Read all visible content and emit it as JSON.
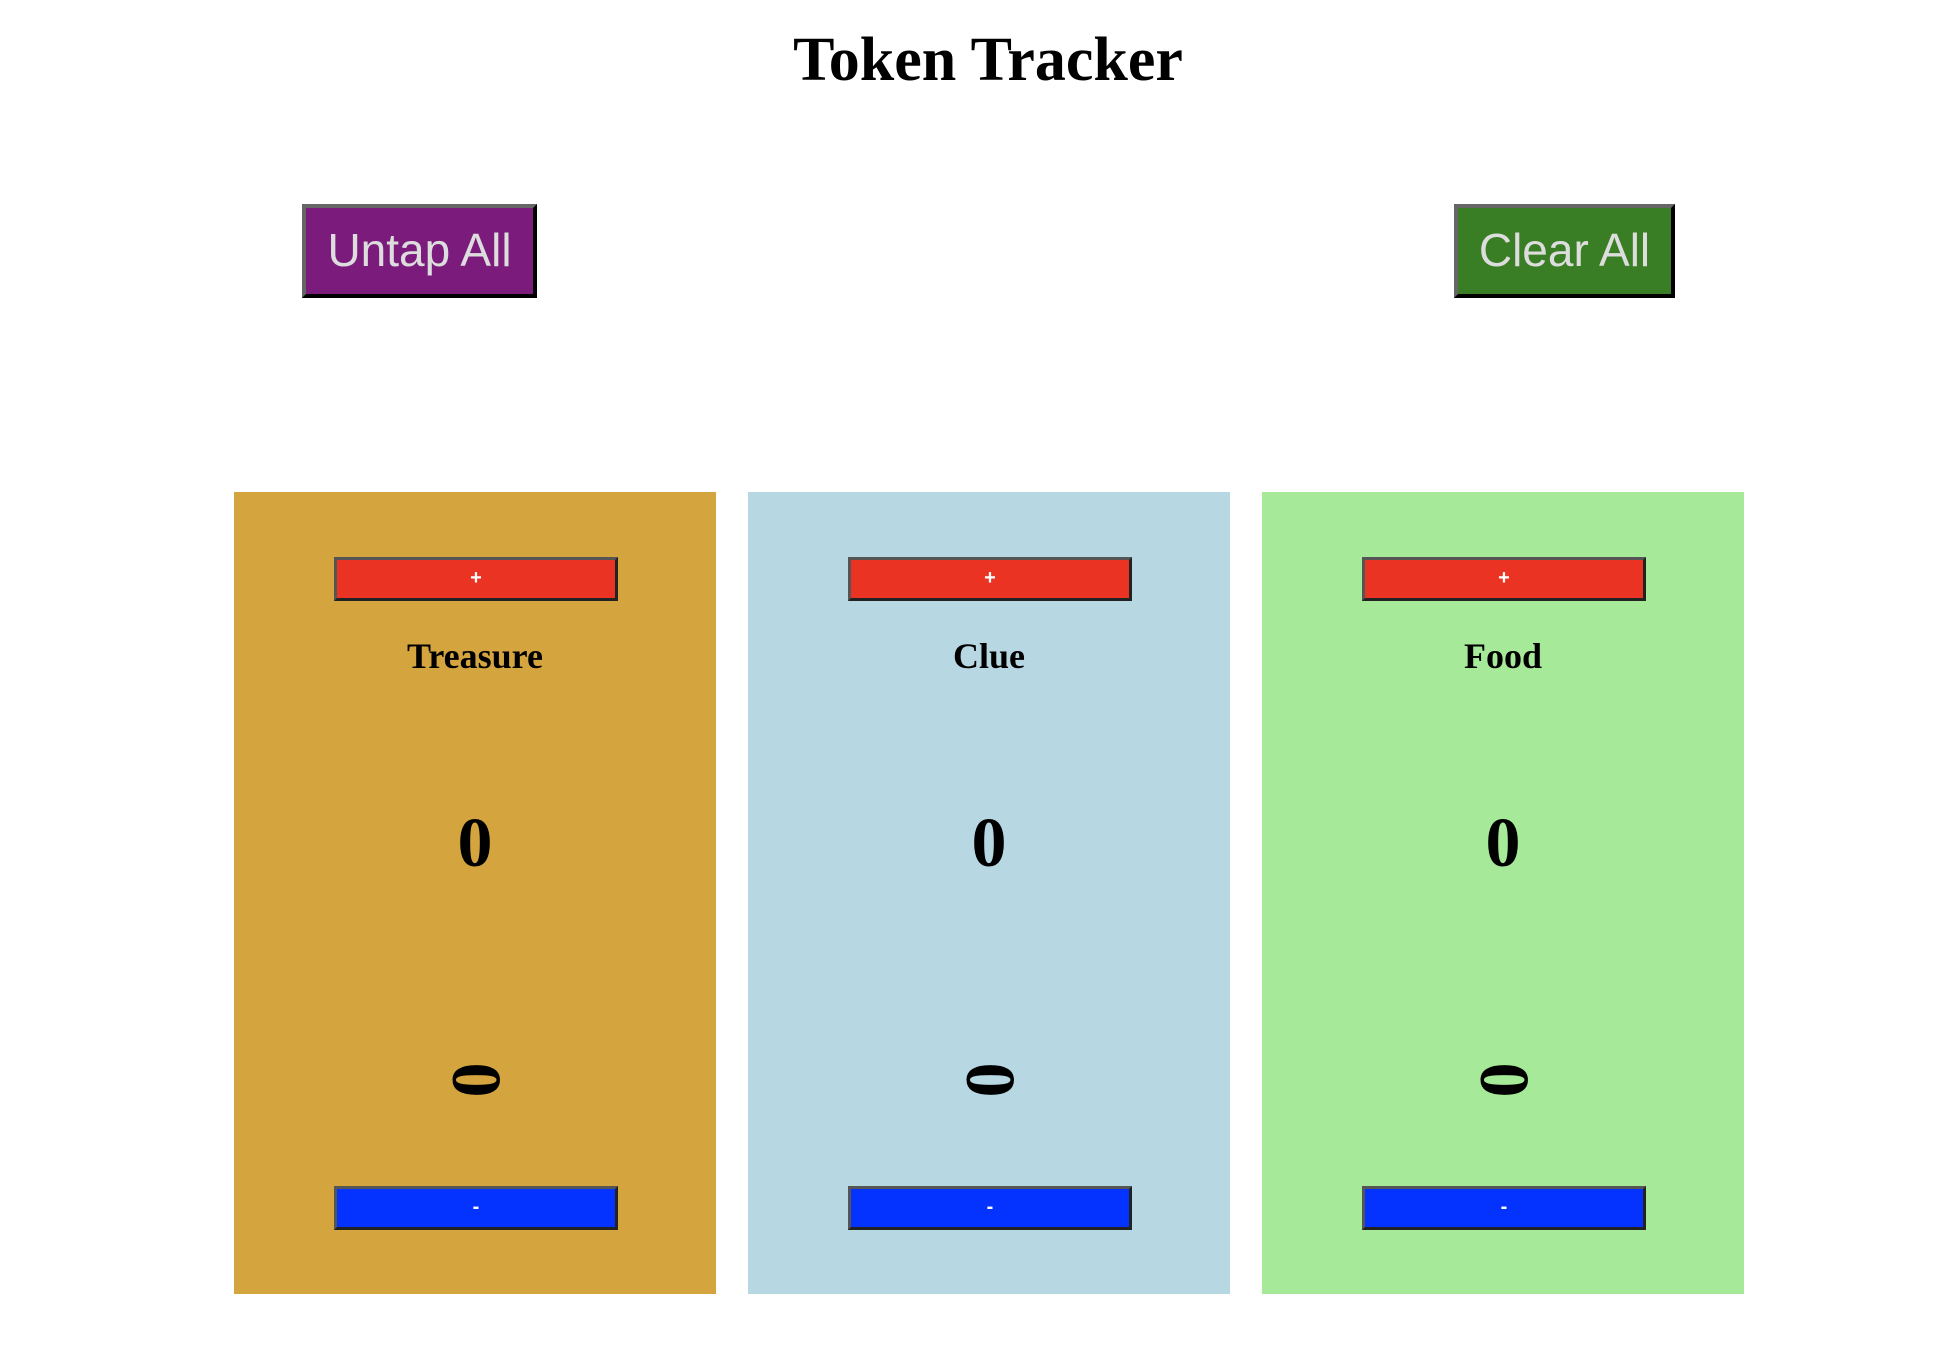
{
  "header": {
    "title": "Token Tracker"
  },
  "controls": {
    "untap_label": "Untap All",
    "clear_label": "Clear All",
    "untap_color": "#7b1c7c",
    "clear_color": "#397d24"
  },
  "tokens": [
    {
      "name": "Treasure",
      "count": "0",
      "tapped": "0",
      "plus_label": "+",
      "minus_label": "-",
      "color": "#d4a53f"
    },
    {
      "name": "Clue",
      "count": "0",
      "tapped": "0",
      "plus_label": "+",
      "minus_label": "-",
      "color": "#b7d7e3"
    },
    {
      "name": "Food",
      "count": "0",
      "tapped": "0",
      "plus_label": "+",
      "minus_label": "-",
      "color": "#a6e998"
    }
  ],
  "colors": {
    "plus_button": "#ea3323",
    "minus_button": "#0433ff"
  }
}
